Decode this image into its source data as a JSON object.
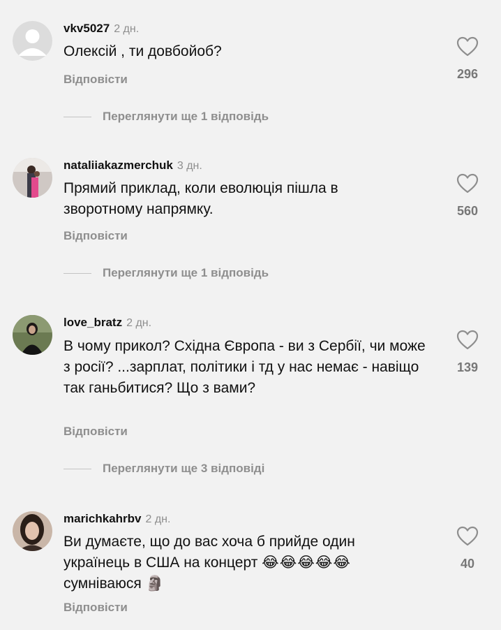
{
  "comments": [
    {
      "username": "vkv5027",
      "time": "2 дн.",
      "text": "Олексій , ти довбойоб?",
      "reply_label": "Відповісти",
      "likes": "296",
      "more_replies": "Переглянути ще 1 відповідь",
      "avatar_icon": "default-avatar-icon"
    },
    {
      "username": "nataliiakazmerchuk",
      "time": "3 дн.",
      "text": "Прямий приклад, коли еволюція пішла в зворотному напрямку.",
      "reply_label": "Відповісти",
      "likes": "560",
      "more_replies": "Переглянути ще 1 відповідь"
    },
    {
      "username": "love_bratz",
      "time": "2 дн.",
      "text": "В чому прикол? Східна Європа - ви з Сербії, чи може з росії? ...зарплат, політики і тд у нас немає - навіщо так ганьбитися? Що з вами?",
      "reply_label": "Відповісти",
      "likes": "139",
      "more_replies": "Переглянути ще 3 відповіді"
    },
    {
      "username": "marichkahrbv",
      "time": "2 дн.",
      "text_line1": "Ви думаєте, що до вас хоча б прийде один",
      "text_line2": "українець в США на концерт",
      "text_line2_emoji": "😂😂😂😂😂",
      "text_line3": "сумніваюся",
      "text_line3_emoji": "🗿",
      "reply_label": "Відповісти",
      "likes": "40"
    }
  ],
  "colors": {
    "background": "#f2f2f2",
    "muted_text": "#8e8e8e",
    "text": "#111111"
  }
}
